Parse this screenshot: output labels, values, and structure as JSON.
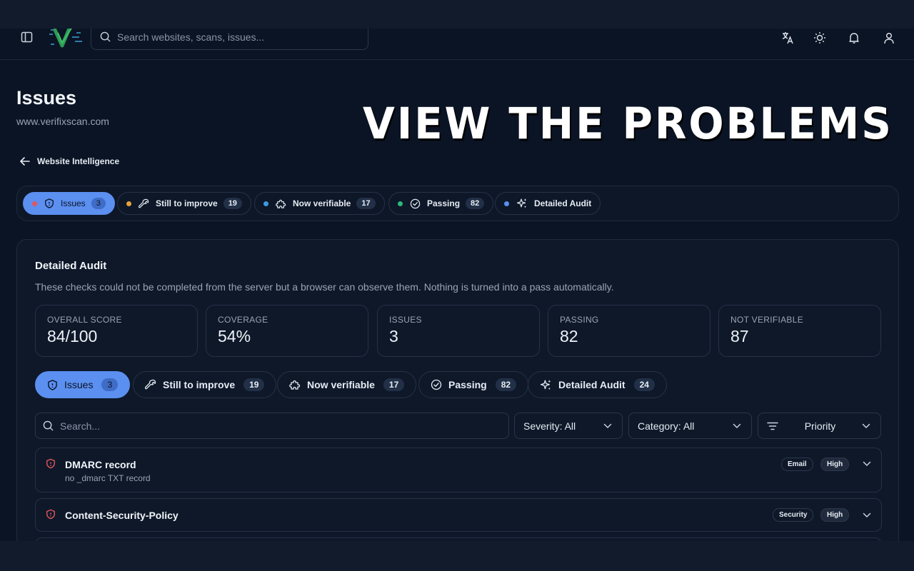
{
  "header": {
    "search_placeholder": "Search websites, scans, issues...",
    "icons": [
      "sidebar-toggle-icon",
      "translate-icon",
      "sun-icon",
      "bell-icon",
      "user-icon"
    ]
  },
  "page": {
    "title": "Issues",
    "subtitle": "www.verifixscan.com",
    "overlay": "View the Problems",
    "back_label": "Website Intelligence"
  },
  "top_tabs": [
    {
      "label": "Issues",
      "count": "3",
      "dot": "#e0565b",
      "icon": "shield-icon",
      "active": true
    },
    {
      "label": "Still to improve",
      "count": "19",
      "dot": "#e6a23c",
      "icon": "wrench-icon"
    },
    {
      "label": "Now verifiable",
      "count": "17",
      "dot": "#3b9ae1",
      "icon": "puzzle-icon"
    },
    {
      "label": "Passing",
      "count": "82",
      "dot": "#2fb67c",
      "icon": "check-circle-icon"
    },
    {
      "label": "Detailed Audit",
      "count": "",
      "dot": "#5b8ff0",
      "icon": "sparkles-icon"
    }
  ],
  "panel": {
    "title": "Detailed Audit",
    "description": "These checks could not be completed from the server but a browser can observe them. Nothing is turned into a pass automatically.",
    "stats": [
      {
        "label": "OVERALL SCORE",
        "value": "84/100"
      },
      {
        "label": "COVERAGE",
        "value": "54%"
      },
      {
        "label": "ISSUES",
        "value": "3"
      },
      {
        "label": "PASSING",
        "value": "82"
      },
      {
        "label": "NOT VERIFIABLE",
        "value": "87"
      }
    ],
    "tabs": [
      {
        "label": "Issues",
        "count": "3",
        "active": true
      },
      {
        "label": "Still to improve",
        "count": "19"
      },
      {
        "label": "Now verifiable",
        "count": "17"
      },
      {
        "label": "Passing",
        "count": "82"
      },
      {
        "label": "Detailed Audit",
        "count": "24"
      }
    ],
    "filters": {
      "search_placeholder": "Search...",
      "severity": "Severity: All",
      "category": "Category: All",
      "sort": "Priority"
    },
    "issues": [
      {
        "name": "DMARC record",
        "detail": "no _dmarc TXT record",
        "category": "Email",
        "severity": "High"
      },
      {
        "name": "Content-Security-Policy",
        "detail": "",
        "category": "Security",
        "severity": "High"
      }
    ]
  },
  "colors": {
    "accent": "#5b8ff0",
    "danger": "#e0565b",
    "background": "#0b1424"
  }
}
